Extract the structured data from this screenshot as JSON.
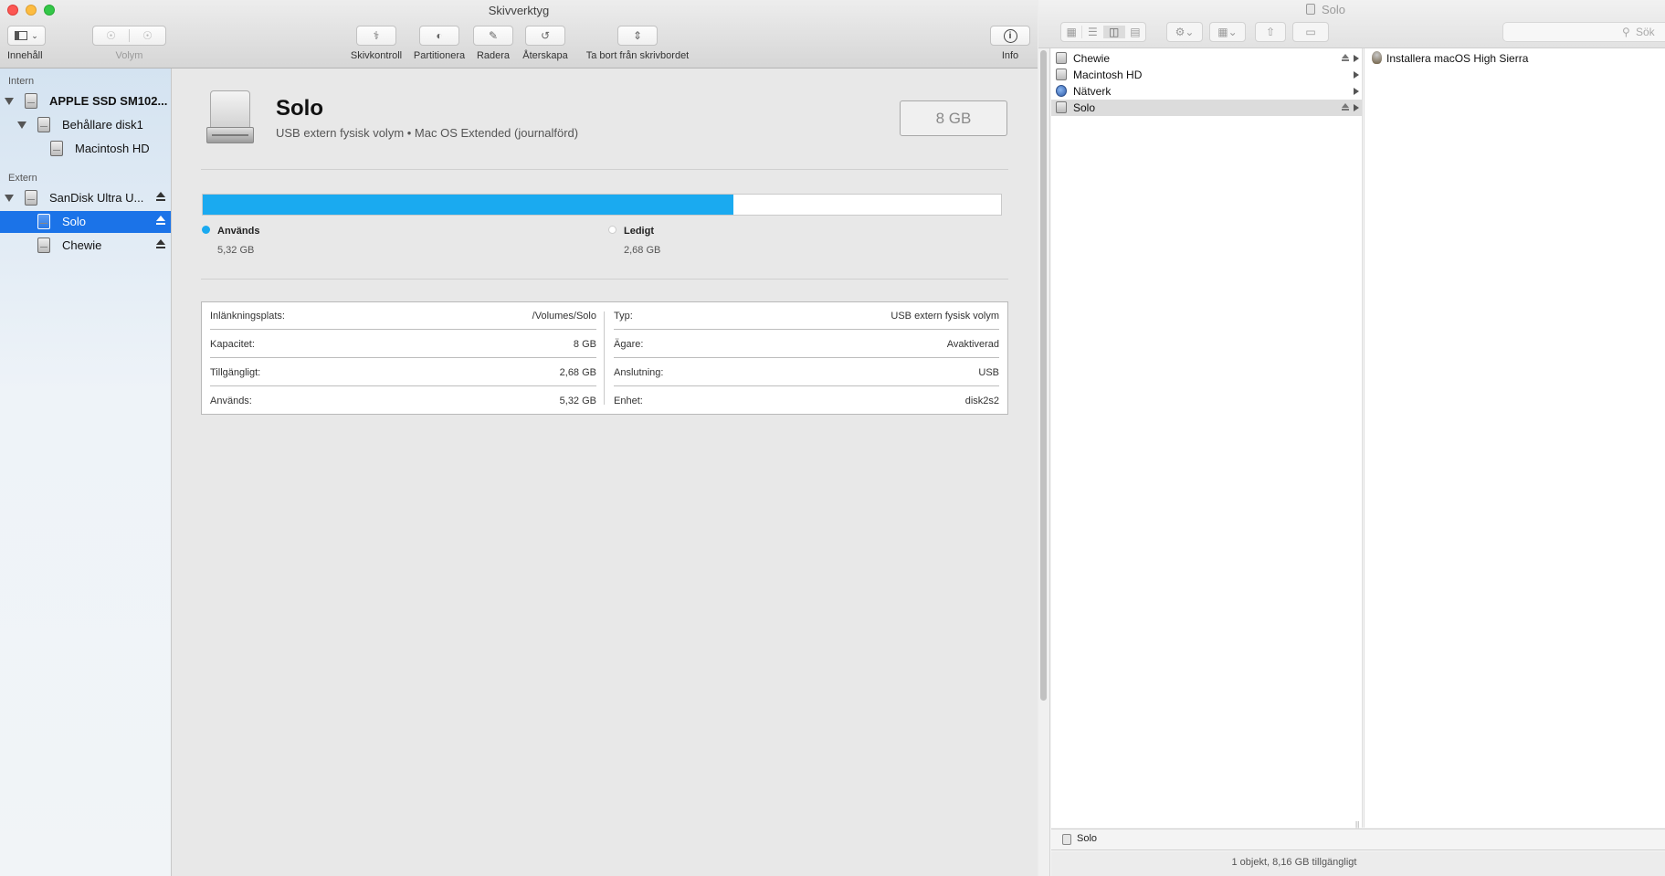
{
  "disk_utility": {
    "window_title": "Skivverktyg",
    "toolbar": {
      "view_label": "Innehåll",
      "volume_label": "Volym",
      "first_aid": "Skivkontroll",
      "partition": "Partitionera",
      "erase": "Radera",
      "restore": "Återskapa",
      "unmount": "Ta bort från skrivbordet",
      "info": "Info"
    },
    "sidebar": {
      "internal_header": "Intern",
      "external_header": "Extern",
      "items": [
        {
          "label": "APPLE SSD SM102..."
        },
        {
          "label": "Behållare disk1"
        },
        {
          "label": "Macintosh HD"
        },
        {
          "label": "SanDisk Ultra U..."
        },
        {
          "label": "Solo"
        },
        {
          "label": "Chewie"
        }
      ]
    },
    "volume": {
      "name": "Solo",
      "subtitle": "USB extern fysisk volym • Mac OS Extended (journalförd)",
      "capacity_badge": "8 GB",
      "used_fraction": 0.665,
      "used_label": "Används",
      "used_value": "5,32 GB",
      "free_label": "Ledigt",
      "free_value": "2,68 GB",
      "used_color": "#1aaaf0",
      "free_color": "#ffffff"
    },
    "info_table": {
      "left": [
        {
          "key": "Inlänkningsplats:",
          "value": "/Volumes/Solo"
        },
        {
          "key": "Kapacitet:",
          "value": "8 GB"
        },
        {
          "key": "Tillgängligt:",
          "value": "2,68 GB"
        },
        {
          "key": "Används:",
          "value": "5,32 GB"
        }
      ],
      "right": [
        {
          "key": "Typ:",
          "value": "USB extern fysisk volym"
        },
        {
          "key": "Ägare:",
          "value": "Avaktiverad"
        },
        {
          "key": "Anslutning:",
          "value": "USB"
        },
        {
          "key": "Enhet:",
          "value": "disk2s2"
        }
      ]
    }
  },
  "finder": {
    "window_title": "Solo",
    "search_placeholder": "Sök",
    "sources": [
      {
        "label": "Chewie",
        "icon": "drive-icon"
      },
      {
        "label": "Macintosh HD",
        "icon": "drive-icon"
      },
      {
        "label": "Nätverk",
        "icon": "globe-icon"
      },
      {
        "label": "Solo",
        "icon": "drive-icon"
      }
    ],
    "files": [
      {
        "label": "Installera macOS High Sierra",
        "icon": "installer-icon"
      }
    ],
    "path_bar": "Solo",
    "status": "1 objekt, 8,16 GB tillgängligt"
  }
}
